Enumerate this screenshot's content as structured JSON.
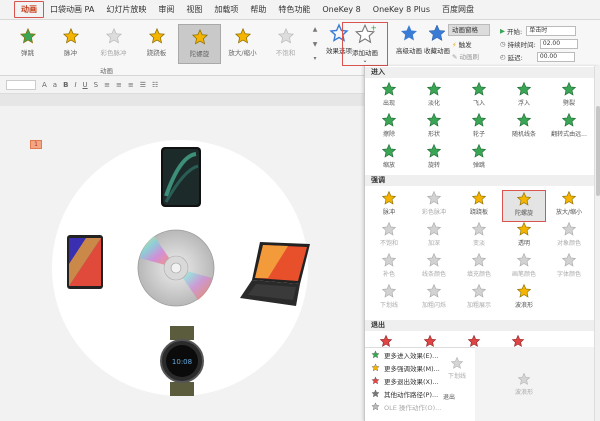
{
  "menu": {
    "tabs": [
      "动画",
      "口袋动画 PA",
      "幻灯片放映",
      "审阅",
      "视图",
      "加载项",
      "帮助",
      "特色功能",
      "OneKey 8",
      "OneKey 8 Plus",
      "百度网盘"
    ]
  },
  "ribbon": {
    "effects": [
      {
        "label": "弹跳",
        "state": "normal"
      },
      {
        "label": "脉冲",
        "state": "normal"
      },
      {
        "label": "彩色脉冲",
        "state": "dim"
      },
      {
        "label": "跷跷板",
        "state": "normal"
      },
      {
        "label": "陀螺旋",
        "state": "selected"
      },
      {
        "label": "放大/缩小",
        "state": "normal"
      },
      {
        "label": "不饱和",
        "state": "dim"
      }
    ],
    "group_label": "动画",
    "effect_options": "效果选项",
    "add_animation": "添加动画",
    "advanced_anim": "高级动画",
    "anim_painter": "收藏动画",
    "anim_pane": "动画窗格",
    "trigger": "触发",
    "anim_brush": "动画刷",
    "timing": {
      "start_label": "开始:",
      "start_value": "单击时",
      "duration_label": "持续时间:",
      "duration_value": "02.00",
      "delay_label": "延迟:",
      "delay_value": "00.00"
    }
  },
  "panel": {
    "sections": {
      "entrance": "进入",
      "emphasis": "强调",
      "exit": "退出"
    },
    "entrance": [
      "出现",
      "淡化",
      "飞入",
      "浮入",
      "劈裂",
      "擦除",
      "形状",
      "轮子",
      "随机线条",
      "翻转式由远...",
      "缩放",
      "旋转",
      "弹跳"
    ],
    "emphasis": [
      "脉冲",
      "彩色脉冲",
      "跷跷板",
      "陀螺旋",
      "放大/缩小",
      "不饱和",
      "加深",
      "变淡",
      "透明",
      "对象颜色",
      "补色",
      "线条颜色",
      "填充颜色",
      "画笔颜色",
      "字体颜色",
      "下划线",
      "加粗闪烁",
      "加粗展示",
      "波浪形"
    ],
    "emphasis_dim": [
      1,
      5,
      6,
      7,
      9,
      10,
      11,
      12,
      13,
      14,
      15,
      16,
      17
    ],
    "exit_partial": [
      "下划线",
      "波浪形"
    ],
    "more": [
      {
        "label": "更多进入效果(E)...",
        "color": "#3aa655",
        "dim": false
      },
      {
        "label": "更多强调效果(M)...",
        "color": "#f5b400",
        "dim": false
      },
      {
        "label": "更多退出效果(X)...",
        "color": "#e04545",
        "dim": false
      },
      {
        "label": "其他动作路径(P)...",
        "color": "#777777",
        "dim": false
      },
      {
        "label": "OLE 操作动作(O)...",
        "color": "#bbbbbb",
        "dim": true
      }
    ],
    "exit_small": "退出"
  },
  "slide": {
    "tag": "1"
  },
  "colors": {
    "accent": "#c43e1c",
    "highlight_border": "#d9534f",
    "star_green": "#3aa655",
    "star_gold": "#f5b400",
    "star_red": "#e04545",
    "star_gray": "#b5b5b5"
  }
}
